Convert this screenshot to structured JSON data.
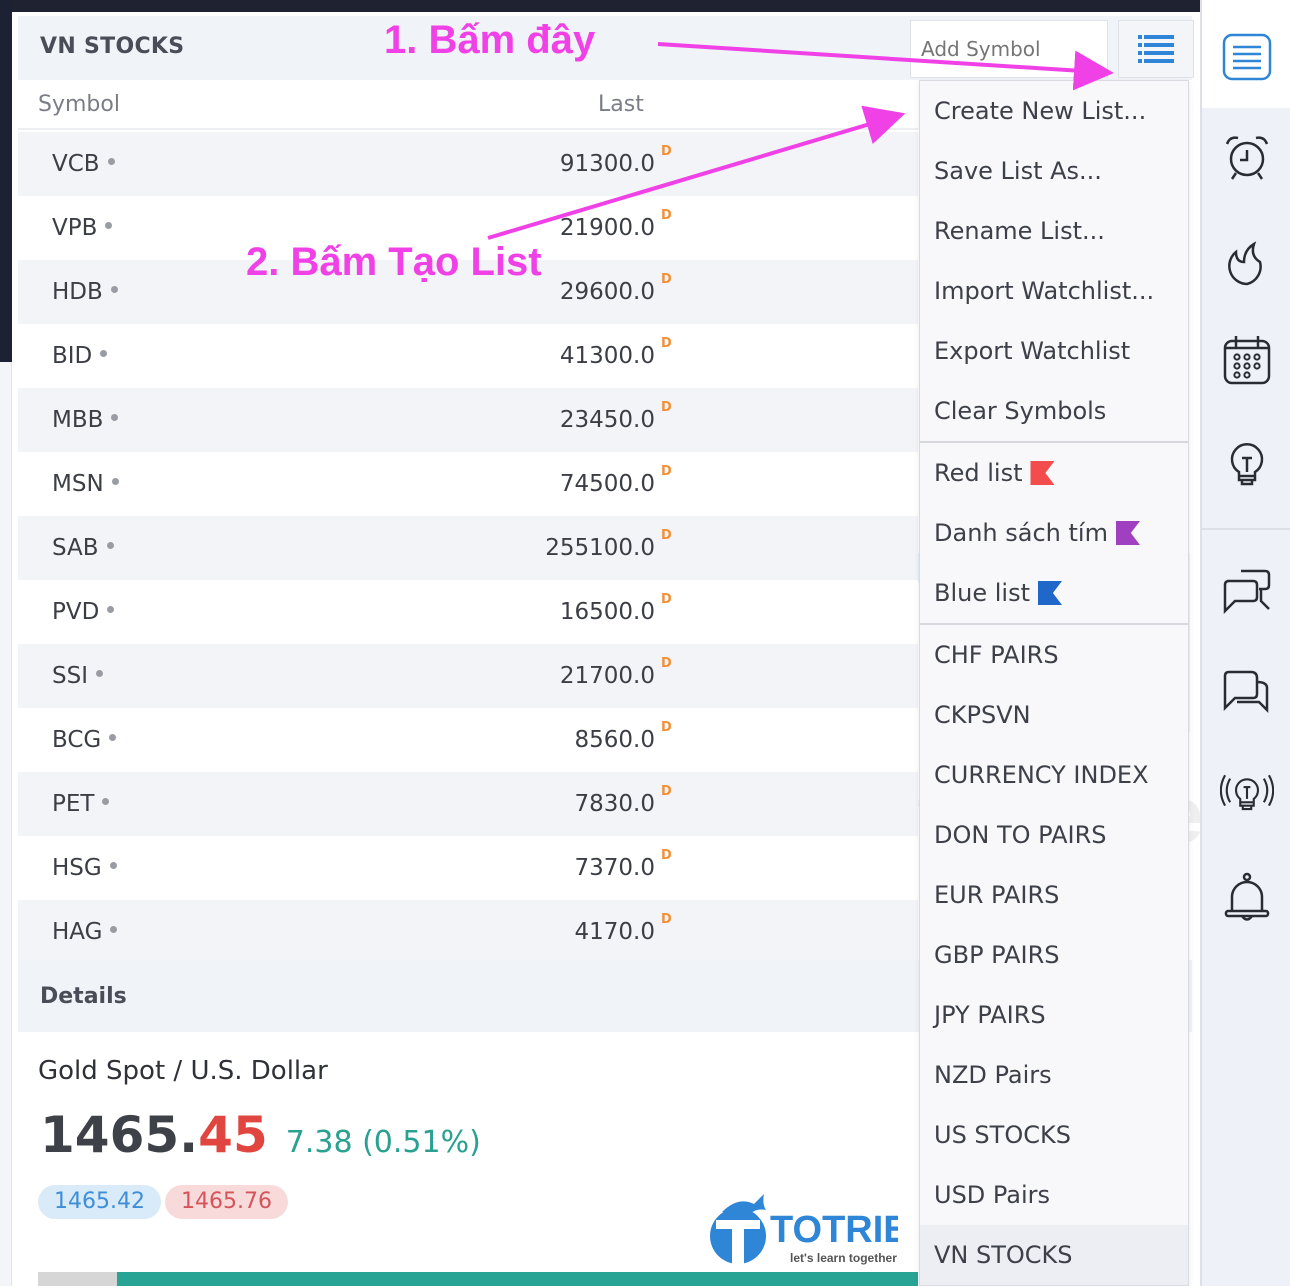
{
  "watchlist": {
    "title": "VN STOCKS",
    "add_symbol_placeholder": "Add Symbol",
    "columns": {
      "symbol": "Symbol",
      "last": "Last"
    },
    "rows": [
      {
        "symbol": "VCB",
        "last": "91300.0",
        "flag": "D"
      },
      {
        "symbol": "VPB",
        "last": "21900.0",
        "flag": "D"
      },
      {
        "symbol": "HDB",
        "last": "29600.0",
        "flag": "D"
      },
      {
        "symbol": "BID",
        "last": "41300.0",
        "flag": "D"
      },
      {
        "symbol": "MBB",
        "last": "23450.0",
        "flag": "D"
      },
      {
        "symbol": "MSN",
        "last": "74500.0",
        "flag": "D"
      },
      {
        "symbol": "SAB",
        "last": "255100.0",
        "flag": "D"
      },
      {
        "symbol": "PVD",
        "last": "16500.0",
        "flag": "D"
      },
      {
        "symbol": "SSI",
        "last": "21700.0",
        "flag": "D"
      },
      {
        "symbol": "BCG",
        "last": "8560.0",
        "flag": "D"
      },
      {
        "symbol": "PET",
        "last": "7830.0",
        "flag": "D"
      },
      {
        "symbol": "HSG",
        "last": "7370.0",
        "flag": "D"
      },
      {
        "symbol": "HAG",
        "last": "4170.0",
        "flag": "D"
      }
    ]
  },
  "menu": {
    "actions": [
      "Create New List...",
      "Save List As...",
      "Rename List...",
      "Import Watchlist...",
      "Export Watchlist",
      "Clear Symbols"
    ],
    "flagged_lists": [
      {
        "label": "Red list",
        "color": "#f24c4c"
      },
      {
        "label": "Danh sách tím",
        "color": "#a040c0"
      },
      {
        "label": "Blue list",
        "color": "#1f67c9"
      }
    ],
    "lists": [
      "CHF PAIRS",
      "CKPSVN",
      "CURRENCY INDEX",
      "DON TO PAIRS",
      "EUR PAIRS",
      "GBP PAIRS",
      "JPY PAIRS",
      "NZD Pairs",
      "US STOCKS",
      "USD Pairs",
      "VN STOCKS"
    ],
    "active_list": "VN STOCKS"
  },
  "details": {
    "header": "Details",
    "instrument": "Gold Spot / U.S. Dollar",
    "price_int": "1465.",
    "price_frac": "45",
    "change": "7.38 (0.51%)",
    "bid": "1465.42",
    "ask": "1465.76",
    "day_range_position": 0.09
  },
  "annotations": {
    "step1": "1. Bấm đây",
    "step2": "2. Bấm Tạo List"
  },
  "watermark": {
    "brand": "TOTRIEU",
    "tagline": "let’s learn together"
  },
  "logo": {
    "brand": "TOTRIEU",
    "tagline": "let's learn together"
  },
  "colors": {
    "accent_blue": "#2f86d6",
    "up_green": "#2aa091",
    "down_red": "#e0463f",
    "annotation_magenta": "#f041e6",
    "delay_orange": "#f0903a"
  },
  "sidebar": {
    "icons": [
      "watchlist-icon",
      "alarm-clock-icon",
      "hotlist-flame-icon",
      "calendar-icon",
      "ideas-lightbulb-icon",
      "public-chats-icon",
      "private-chats-icon",
      "ideas-stream-icon",
      "notifications-bell-icon"
    ]
  }
}
